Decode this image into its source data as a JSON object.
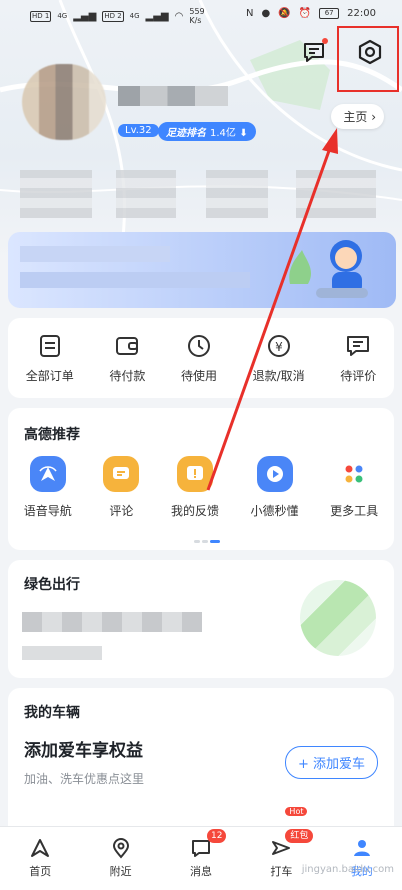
{
  "status_bar": {
    "sim1": "HD 1",
    "sim1_signal": "4G",
    "sim2": "HD 2",
    "sim2_signal": "4G",
    "speed_value": "559",
    "speed_unit": "K/s",
    "battery": "67",
    "time": "22:00"
  },
  "profile": {
    "level": "Lv.32",
    "rank_label": "足迹排名",
    "rank_value": "1.4亿"
  },
  "homepage_button": "主页",
  "orders": [
    {
      "label": "全部订单",
      "icon": "document-icon"
    },
    {
      "label": "待付款",
      "icon": "wallet-icon"
    },
    {
      "label": "待使用",
      "icon": "clock-icon"
    },
    {
      "label": "退款/取消",
      "icon": "yuan-refund-icon"
    },
    {
      "label": "待评价",
      "icon": "comment-icon"
    }
  ],
  "recommend": {
    "title": "高德推荐",
    "items": [
      {
        "label": "语音导航",
        "icon": "voice-nav-icon",
        "color": "#4a86f7"
      },
      {
        "label": "评论",
        "icon": "review-icon",
        "color": "#f6b33c"
      },
      {
        "label": "我的反馈",
        "icon": "feedback-icon",
        "color": "#f6b33c"
      },
      {
        "label": "小德秒懂",
        "icon": "play-icon",
        "color": "#4a86f7"
      },
      {
        "label": "更多工具",
        "icon": "grid-icon",
        "color": "#f0f2f5"
      }
    ]
  },
  "green_travel": {
    "title": "绿色出行"
  },
  "vehicle": {
    "title": "我的车辆",
    "headline": "添加爱车享权益",
    "subtitle": "加油、洗车优惠点这里",
    "add_button": "添加爱车"
  },
  "nav": [
    {
      "label": "首页",
      "icon": "home-icon"
    },
    {
      "label": "附近",
      "icon": "location-icon"
    },
    {
      "label": "消息",
      "icon": "message-icon",
      "badge": "12"
    },
    {
      "label": "打车",
      "icon": "taxi-icon",
      "badge": "红包",
      "hot": "Hot"
    },
    {
      "label": "我的",
      "icon": "profile-icon"
    }
  ],
  "watermark": "jingyan.baidu.com",
  "colors": {
    "accent": "#3f86ff",
    "annotation": "#e8302a",
    "badge": "#f5483b"
  }
}
